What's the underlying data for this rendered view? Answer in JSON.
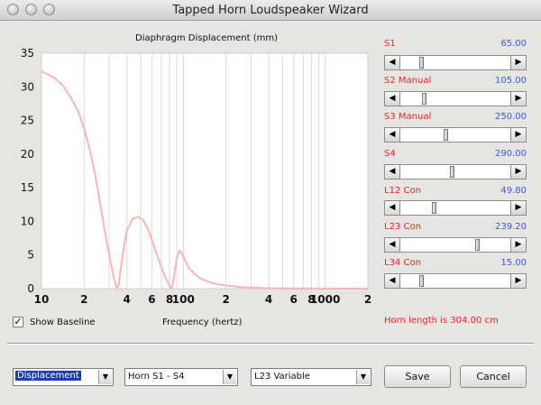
{
  "window": {
    "title": "Tapped Horn Loudspeaker Wizard"
  },
  "chart": {
    "title": "Diaphragm Displacement (mm)",
    "xlabel": "Frequency (hertz)"
  },
  "chart_data": {
    "type": "line",
    "title": "Diaphragm Displacement (mm)",
    "xlabel": "Frequency (hertz)",
    "ylabel": "",
    "xscale": "log",
    "xlim": [
      10,
      2000
    ],
    "ylim": [
      0,
      35
    ],
    "yticks": [
      0,
      5,
      10,
      15,
      20,
      25,
      30,
      35
    ],
    "xtick_labels": [
      {
        "value": 10,
        "label": "10"
      },
      {
        "value": 20,
        "label": "2"
      },
      {
        "value": 40,
        "label": "4"
      },
      {
        "value": 60,
        "label": "6"
      },
      {
        "value": 80,
        "label": "8"
      },
      {
        "value": 100,
        "label": "100"
      },
      {
        "value": 200,
        "label": "2"
      },
      {
        "value": 400,
        "label": "4"
      },
      {
        "value": 600,
        "label": "6"
      },
      {
        "value": 800,
        "label": "8"
      },
      {
        "value": 1000,
        "label": "1000"
      },
      {
        "value": 2000,
        "label": "2"
      }
    ],
    "grid": true,
    "series": [
      {
        "color": "#f7b5b5",
        "x": [
          10,
          12,
          14,
          16,
          18,
          20,
          22,
          24,
          26,
          28,
          30,
          32,
          34,
          35,
          36,
          38,
          40,
          44,
          48,
          52,
          56,
          60,
          64,
          68,
          72,
          76,
          80,
          82,
          84,
          86,
          88,
          90,
          94,
          98,
          104,
          110,
          120,
          130,
          150,
          170,
          200,
          250,
          300,
          400,
          500,
          600,
          800,
          1000,
          1500,
          2000
        ],
        "y": [
          32.3,
          31.5,
          30.3,
          28.5,
          26.5,
          23.8,
          20.5,
          16.8,
          12.5,
          8.5,
          5.0,
          2.0,
          0.1,
          0.5,
          2.5,
          6.0,
          8.6,
          10.4,
          10.7,
          10.2,
          9.0,
          7.3,
          5.5,
          3.9,
          2.5,
          1.3,
          0.4,
          0.1,
          0.6,
          1.8,
          3.2,
          4.6,
          5.6,
          5.2,
          4.0,
          3.0,
          2.2,
          1.6,
          1.0,
          0.7,
          0.45,
          0.25,
          0.15,
          0.07,
          0.04,
          0.02,
          0.01,
          0.0,
          0.0,
          0.0
        ]
      }
    ]
  },
  "baseline": {
    "checked": true,
    "checkmark": "✓",
    "label": "Show Baseline"
  },
  "parameters": [
    {
      "label": "S1",
      "value": "65.00",
      "position": 0.18
    },
    {
      "label": "S2  Manual",
      "value": "105.00",
      "position": 0.2
    },
    {
      "label": "S3  Manual",
      "value": "250.00",
      "position": 0.4
    },
    {
      "label": "S4",
      "value": "290.00",
      "position": 0.46
    },
    {
      "label": "L12  Con",
      "value": "49.80",
      "position": 0.29
    },
    {
      "label": "L23  Con",
      "value": "239.20",
      "position": 0.7
    },
    {
      "label": "L34  Con",
      "value": "15.00",
      "position": 0.18
    }
  ],
  "horn_length": "Horn length is 304.00 cm",
  "controls": {
    "plot_select": "Displacement",
    "horn_select": "Horn S1 - S4",
    "variable_select": "L23 Variable",
    "save_label": "Save",
    "cancel_label": "Cancel"
  },
  "arrows": {
    "left": "◀",
    "right": "▶",
    "down": "▼"
  }
}
